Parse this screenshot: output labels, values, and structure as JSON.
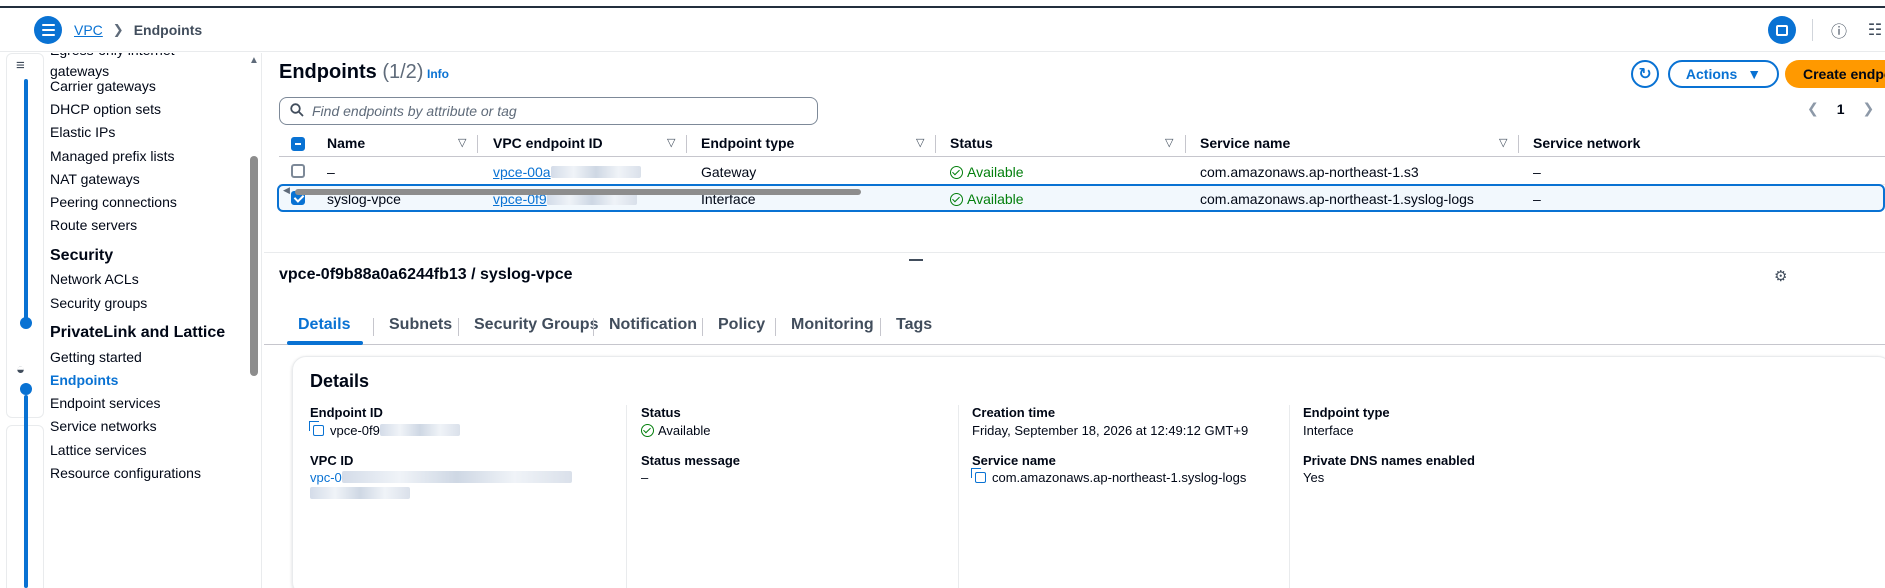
{
  "breadcrumb": {
    "root": "VPC",
    "current": "Endpoints"
  },
  "nav": {
    "items_top": [
      "Egress-only internet gateways",
      "Carrier gateways",
      "DHCP option sets",
      "Elastic IPs",
      "Managed prefix lists",
      "NAT gateways",
      "Peering connections",
      "Route servers"
    ],
    "security_head": "Security",
    "security_items": [
      "Network ACLs",
      "Security groups"
    ],
    "privatelink_head": "PrivateLink and Lattice",
    "privatelink_items": [
      "Getting started",
      "Endpoints",
      "Endpoint services",
      "Service networks",
      "Lattice services",
      "Resource configurations"
    ]
  },
  "header": {
    "title": "Endpoints",
    "count": "(1/2)",
    "info": "Info",
    "actions": "Actions",
    "create": "Create endpoint",
    "search_placeholder": "Find endpoints by attribute or tag",
    "page": "1"
  },
  "columns": [
    "Name",
    "VPC endpoint ID",
    "Endpoint type",
    "Status",
    "Service name",
    "Service network"
  ],
  "rows": [
    {
      "name": "–",
      "id": "vpce-00a",
      "type": "Gateway",
      "status": "Available",
      "service": "com.amazonaws.ap-northeast-1.s3",
      "network": "–",
      "selected": false
    },
    {
      "name": "syslog-vpce",
      "id": "vpce-0f9",
      "type": "Interface",
      "status": "Available",
      "service": "com.amazonaws.ap-northeast-1.syslog-logs",
      "network": "–",
      "selected": true
    }
  ],
  "detail": {
    "heading": "vpce-0f9b88a0a6244fb13 / syslog-vpce",
    "tabs": [
      "Details",
      "Subnets",
      "Security Groups",
      "Notification",
      "Policy",
      "Monitoring",
      "Tags"
    ],
    "card_title": "Details",
    "endpoint_id_label": "Endpoint ID",
    "endpoint_id_value": "vpce-0f9",
    "vpc_id_label": "VPC ID",
    "vpc_id_value": "vpc-0",
    "status_label": "Status",
    "status_value": "Available",
    "status_message_label": "Status message",
    "status_message_value": "–",
    "creation_time_label": "Creation time",
    "creation_time_value": "Friday, September 18, 2026 at 12:49:12 GMT+9",
    "service_name_label": "Service name",
    "service_name_value": "com.amazonaws.ap-northeast-1.syslog-logs",
    "endpoint_type_label": "Endpoint type",
    "endpoint_type_value": "Interface",
    "private_dns_label": "Private DNS names enabled",
    "private_dns_value": "Yes"
  },
  "colors": {
    "accent": "#0972d3",
    "primary_button": "#ff9900",
    "success": "#037f0c"
  },
  "icons": [
    "menu-icon",
    "chevron-right-icon",
    "panel-icon",
    "info-icon",
    "settings-sliders-icon",
    "refresh-icon",
    "caret-down-icon",
    "search-icon",
    "sort-icon",
    "check-circle-icon",
    "copy-icon",
    "gear-icon"
  ]
}
